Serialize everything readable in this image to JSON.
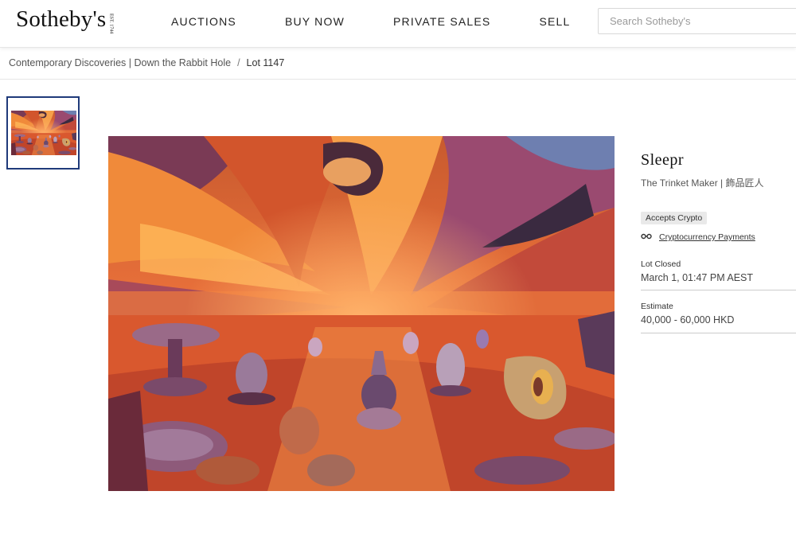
{
  "header": {
    "logo_text": "Sotheby's",
    "logo_est": "EST. 1744",
    "nav": [
      {
        "label": "AUCTIONS"
      },
      {
        "label": "BUY NOW"
      },
      {
        "label": "PRIVATE SALES"
      },
      {
        "label": "SELL"
      }
    ],
    "search_placeholder": "Search Sotheby's"
  },
  "breadcrumb": {
    "parent": "Contemporary Discoveries | Down the Rabbit Hole",
    "separator": "/",
    "current": "Lot 1147"
  },
  "lot": {
    "title": "Sleepr",
    "artist": "The Trinket Maker | 飾品匠人",
    "crypto_badge": "Accepts Crypto",
    "crypto_icon": "link-icon",
    "crypto_link": "Cryptocurrency Payments",
    "status_label": "Lot Closed",
    "status_value": "March 1, 01:47 PM AEST",
    "estimate_label": "Estimate",
    "estimate_value": "40,000 - 60,000 HKD"
  },
  "colors": {
    "thumb_border": "#1f3a7a",
    "art_orange": "#e8672a",
    "art_purple": "#7a4a6e"
  }
}
